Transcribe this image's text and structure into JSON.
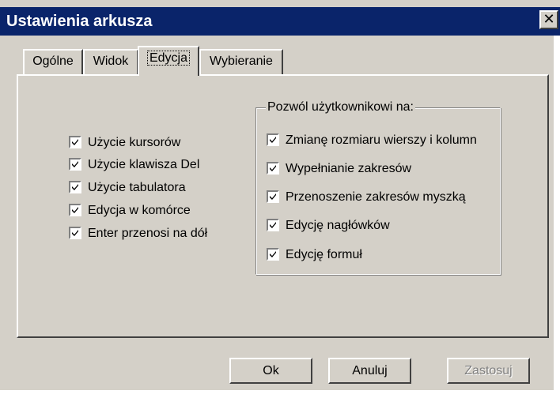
{
  "window": {
    "title": "Ustawienia arkusza",
    "close_label": "✕"
  },
  "tabs": [
    {
      "label": "Ogólne"
    },
    {
      "label": "Widok"
    },
    {
      "label": "Edycja",
      "active": true
    },
    {
      "label": "Wybieranie"
    }
  ],
  "left_options": [
    {
      "label": "Użycie kursorów",
      "checked": true
    },
    {
      "label": "Użycie klawisza Del",
      "checked": true
    },
    {
      "label": "Użycie tabulatora",
      "checked": true
    },
    {
      "label": "Edycja w komórce",
      "checked": true
    },
    {
      "label": "Enter przenosi na dół",
      "checked": true
    }
  ],
  "group": {
    "title": "Pozwól użytkownikowi na:",
    "options": [
      {
        "label": "Zmianę rozmiaru wierszy i kolumn",
        "checked": true
      },
      {
        "label": "Wypełnianie zakresów",
        "checked": true
      },
      {
        "label": "Przenoszenie zakresów myszką",
        "checked": true
      },
      {
        "label": "Edycję nagłówków",
        "checked": true
      },
      {
        "label": "Edycję formuł",
        "checked": true
      }
    ]
  },
  "buttons": {
    "ok": "Ok",
    "cancel": "Anuluj",
    "apply": "Zastosuj"
  }
}
